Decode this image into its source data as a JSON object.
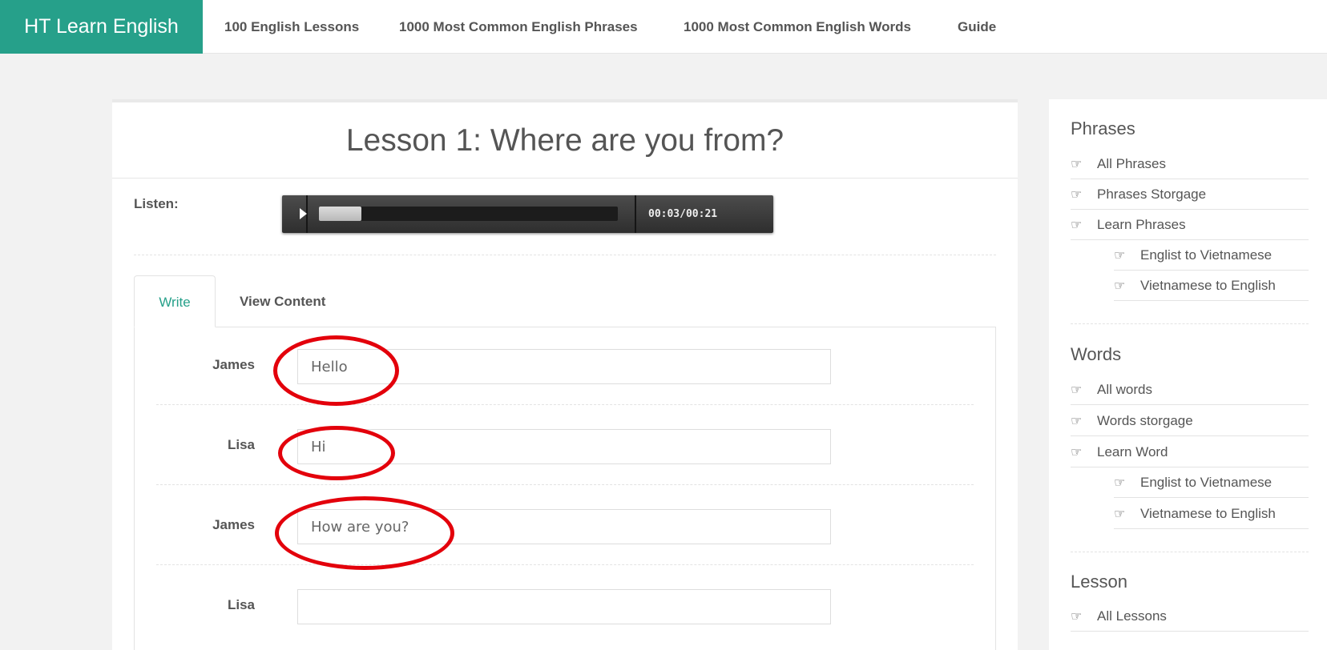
{
  "nav": {
    "brand": "HT Learn English",
    "links": [
      "100 English Lessons",
      "1000 Most Common English Phrases",
      "1000 Most Common English Words",
      "Guide"
    ]
  },
  "lesson": {
    "title": "Lesson 1: Where are you from?",
    "listen_label": "Listen:",
    "player": {
      "current": "00:03",
      "separator": "/",
      "duration": "00:21",
      "progress": 0.143,
      "play_icon": "play-icon"
    },
    "tabs": [
      "Write",
      "View Content"
    ],
    "rows": [
      {
        "speaker": "James",
        "value": "Hello"
      },
      {
        "speaker": "Lisa",
        "value": "Hi"
      },
      {
        "speaker": "James",
        "value": "How are you?"
      },
      {
        "speaker": "Lisa",
        "value": ""
      }
    ]
  },
  "sidebar": {
    "phrases": {
      "heading": "Phrases",
      "items": [
        "All Phrases",
        "Phrases Storgage",
        "Learn Phrases"
      ],
      "sub": [
        "Englist to Vietnamese",
        "Vietnamese to English"
      ]
    },
    "words": {
      "heading": "Words",
      "items": [
        "All words",
        "Words storgage",
        "Learn Word"
      ],
      "sub": [
        "Englist to Vietnamese",
        "Vietnamese to English"
      ]
    },
    "lesson": {
      "heading": "Lesson",
      "items": [
        "All Lessons"
      ]
    },
    "item_icon": "hand-pointing-right-icon"
  },
  "colors": {
    "brand": "#26a08a",
    "annotation": "#e3000b"
  }
}
